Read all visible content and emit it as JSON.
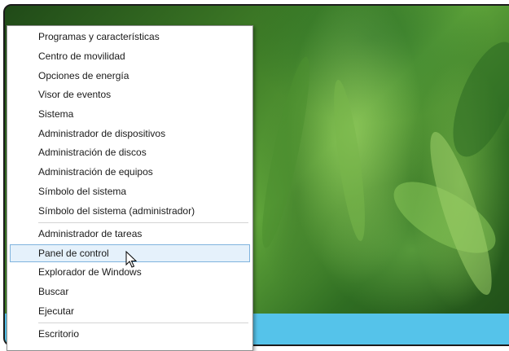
{
  "context_menu": {
    "items": [
      {
        "label": "Programas y características"
      },
      {
        "label": "Centro de movilidad"
      },
      {
        "label": "Opciones de energía"
      },
      {
        "label": "Visor de eventos"
      },
      {
        "label": "Sistema"
      },
      {
        "label": "Administrador de dispositivos"
      },
      {
        "label": "Administración de discos"
      },
      {
        "label": "Administración de equipos"
      },
      {
        "label": "Símbolo del sistema"
      },
      {
        "label": "Símbolo del sistema (administrador)"
      },
      {
        "label": "Administrador de tareas"
      },
      {
        "label": "Panel de control",
        "highlighted": true
      },
      {
        "label": "Explorador de Windows"
      },
      {
        "label": "Buscar"
      },
      {
        "label": "Ejecutar"
      },
      {
        "label": "Escritorio"
      }
    ]
  },
  "colors": {
    "highlight_fill": "#e5f1fb",
    "highlight_border": "#7fb3de",
    "taskbar": "#55c3ea"
  },
  "icons": [
    "mouse-pointer-icon"
  ]
}
